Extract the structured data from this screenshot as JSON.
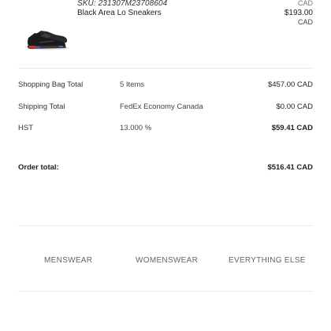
{
  "product": {
    "sku": "SKU: 231307M23708604",
    "name": "Black Area Lo Sneakers",
    "currency_top": "CAD",
    "price": "$193.00",
    "currency": "CAD",
    "image_icon": "sneaker-image"
  },
  "summary": {
    "bag_total": {
      "label": "Shopping Bag Total",
      "detail": "5 Items",
      "amount": "$457.00 CAD"
    },
    "shipping": {
      "label": "Shipping Total",
      "detail": "FedEx Economy Canada",
      "amount": "$0.00 CAD"
    },
    "tax": {
      "label": "HST",
      "detail": "13.000 %",
      "amount": "$59.41 CAD"
    },
    "order_total": {
      "label": "Order total:",
      "amount": "$516.41 CAD"
    }
  },
  "footer_nav": {
    "menswear": "MENSWEAR",
    "womenswear": "WOMENSWEAR",
    "everything_else": "EVERYTHING ELSE"
  }
}
